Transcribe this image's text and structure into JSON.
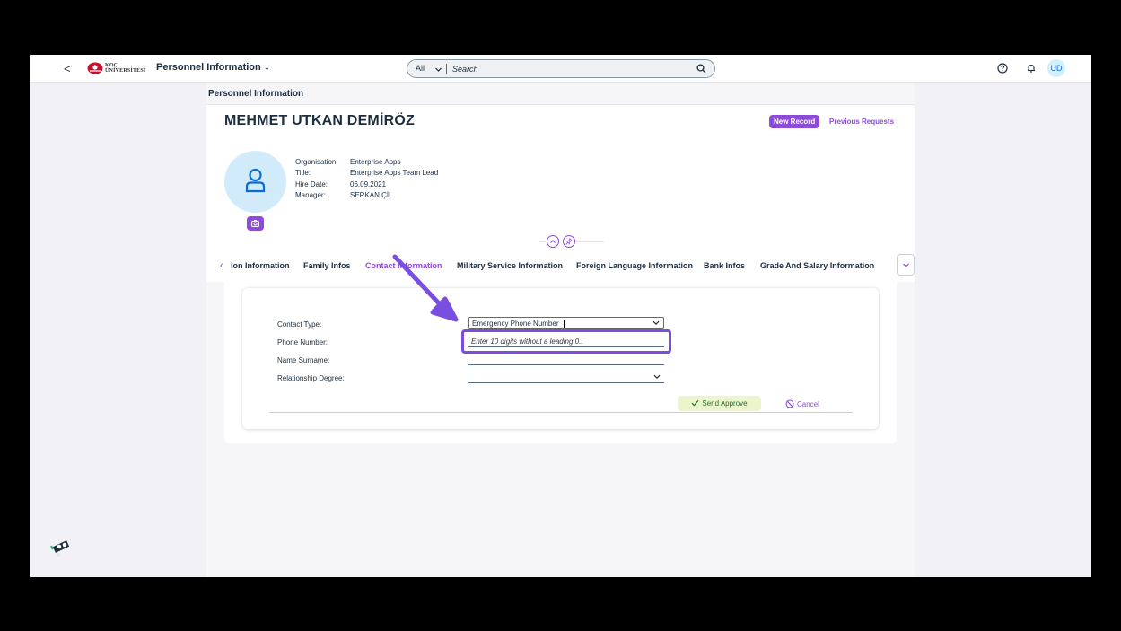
{
  "shell": {
    "back_label": "<",
    "logo_line1": "KOÇ",
    "logo_line2": "ÜNİVERSİTESİ",
    "app_title": "Personnel Information",
    "search_scope": "All",
    "search_placeholder": "Search",
    "avatar_initials": "UD"
  },
  "page": {
    "breadcrumb": "Personnel Information",
    "employee_name": "MEHMET UTKAN DEMİRÖZ",
    "new_record_label": "New Record",
    "previous_requests_label": "Previous Requests"
  },
  "facts": [
    {
      "label": "Organisation:",
      "value": "Enterprise Apps"
    },
    {
      "label": "Title:",
      "value": "Enterprise Apps Team Lead"
    },
    {
      "label": "Hire Date:",
      "value": "06.09.2021"
    },
    {
      "label": "Manager:",
      "value": "SERKAN ÇİL"
    }
  ],
  "tabs": [
    {
      "label": "ion Information",
      "active": false
    },
    {
      "label": "Family Infos",
      "active": false
    },
    {
      "label": "Contact Information",
      "active": true
    },
    {
      "label": "Military Service Information",
      "active": false
    },
    {
      "label": "Foreign Language Information",
      "active": false
    },
    {
      "label": "Bank Infos",
      "active": false
    },
    {
      "label": "Grade And Salary Information",
      "active": false
    }
  ],
  "form": {
    "contact_type_label": "Contact Type:",
    "contact_type_value": "Emergency Phone Number",
    "phone_label": "Phone Number:",
    "phone_placeholder": "Enter 10 digits without a leading 0..",
    "name_label": "Name Surname:",
    "relationship_label": "Relationship Degree:",
    "relationship_value": "",
    "send_label": "Send Approve",
    "cancel_label": "Cancel"
  },
  "colors": {
    "accent": "#8e4bd8",
    "annotation": "#7a4fe0",
    "send_bg": "#ebf5cb",
    "send_text": "#256f3a"
  }
}
